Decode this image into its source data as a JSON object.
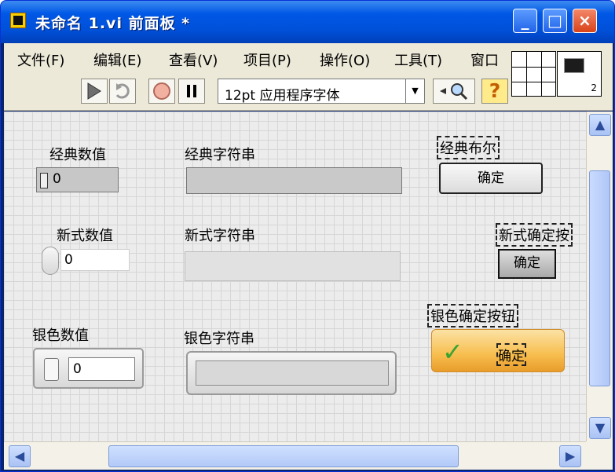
{
  "window": {
    "title": "未命名 1.vi 前面板 *",
    "buttons": {
      "minimize": "_",
      "maximize": "□",
      "close": "×"
    }
  },
  "menu": [
    {
      "label": "文件(F)"
    },
    {
      "label": "编辑(E)"
    },
    {
      "label": "查看(V)"
    },
    {
      "label": "项目(P)"
    },
    {
      "label": "操作(O)"
    },
    {
      "label": "工具(T)"
    },
    {
      "label": "窗口"
    }
  ],
  "toolbar": {
    "font": "12pt 应用程序字体",
    "icon_number": "2"
  },
  "controls": {
    "classic_numeric": {
      "label": "经典数值",
      "value": "0"
    },
    "classic_string": {
      "label": "经典字符串"
    },
    "classic_boolean": {
      "label": "经典布尔",
      "button": "确定"
    },
    "modern_numeric": {
      "label": "新式数值",
      "value": "0"
    },
    "modern_string": {
      "label": "新式字符串"
    },
    "modern_ok": {
      "label": "新式确定按",
      "button": "确定"
    },
    "silver_numeric": {
      "label": "银色数值",
      "value": "0"
    },
    "silver_string": {
      "label": "银色字符串"
    },
    "silver_ok": {
      "label": "银色确定按钮",
      "button": "确定"
    }
  }
}
